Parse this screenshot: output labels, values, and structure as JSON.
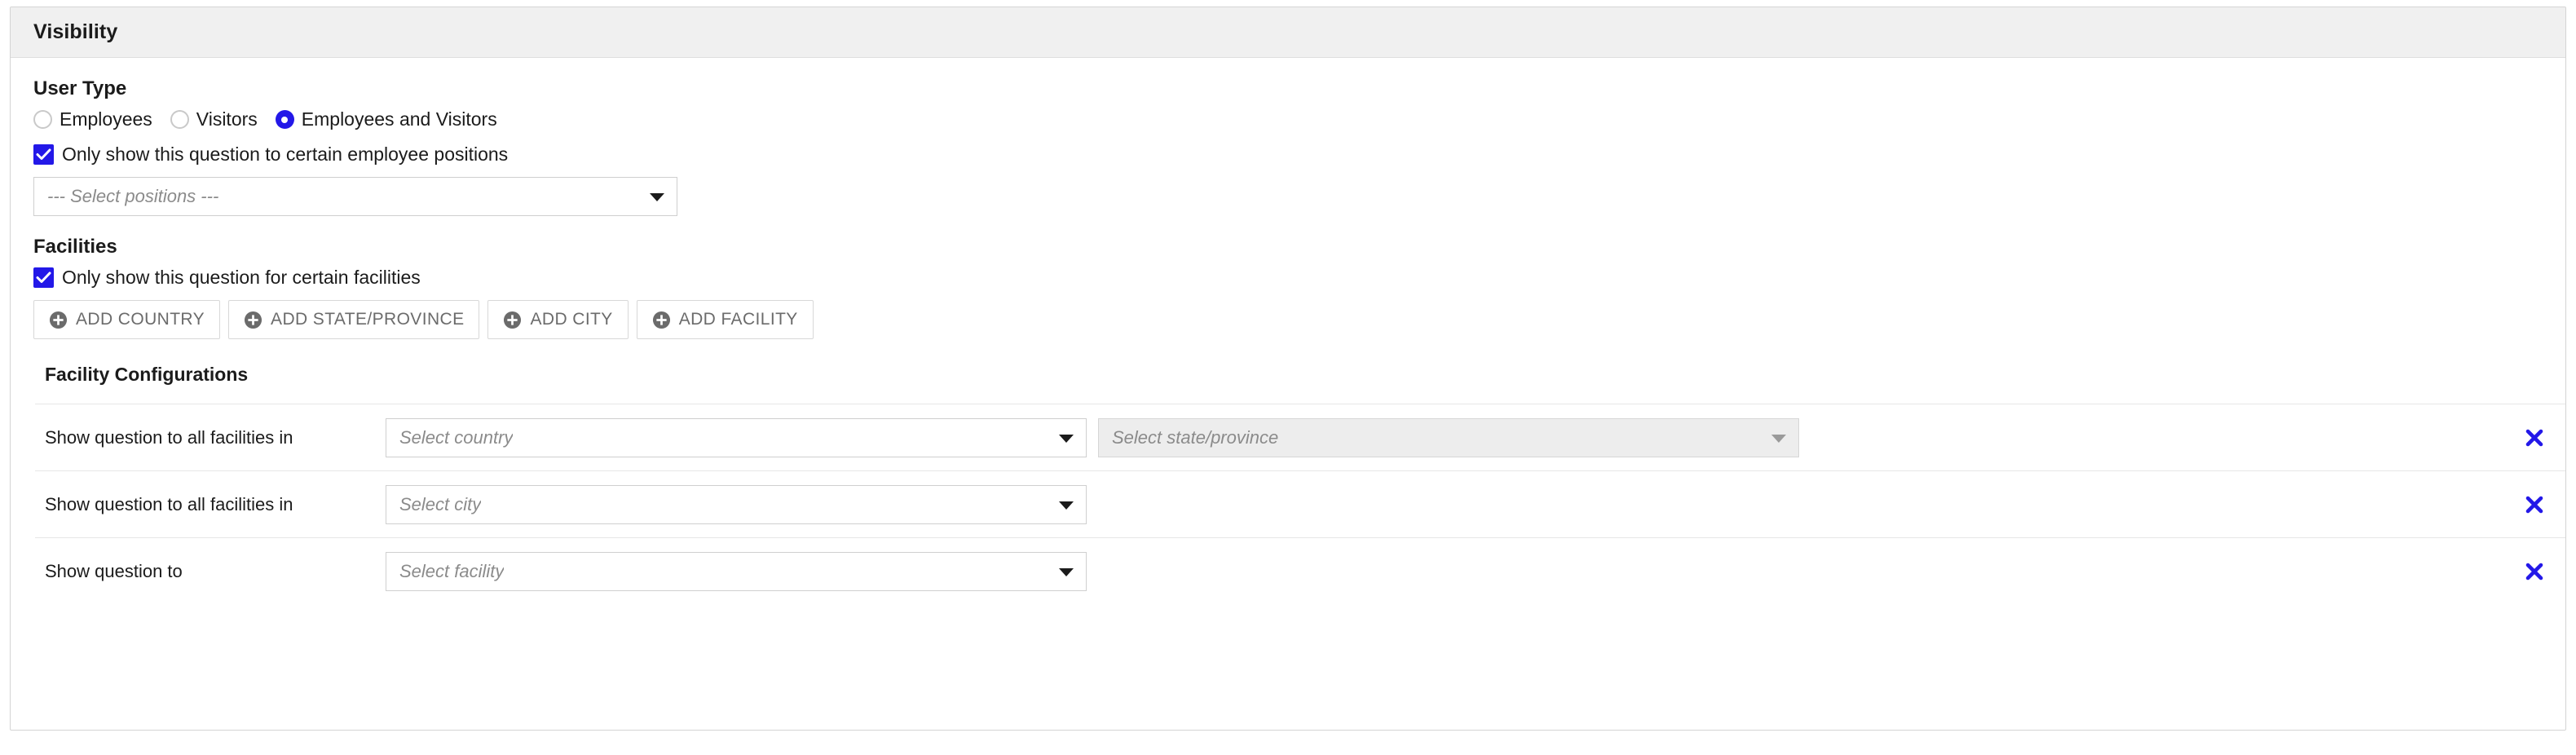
{
  "panel": {
    "header_title": "Visibility"
  },
  "user_type": {
    "section_label": "User Type",
    "options": [
      {
        "label": "Employees",
        "selected": false
      },
      {
        "label": "Visitors",
        "selected": false
      },
      {
        "label": "Employees and Visitors",
        "selected": true
      }
    ],
    "positions_checkbox": {
      "label": "Only show this question to certain employee positions",
      "checked": true
    },
    "positions_select": {
      "placeholder": "--- Select positions ---",
      "value": ""
    }
  },
  "facilities": {
    "section_label": "Facilities",
    "facilities_checkbox": {
      "label": "Only show this question for certain facilities",
      "checked": true
    },
    "add_buttons": [
      {
        "label": "ADD COUNTRY",
        "icon": "plus-circle-icon"
      },
      {
        "label": "ADD STATE/PROVINCE",
        "icon": "plus-circle-icon"
      },
      {
        "label": "ADD CITY",
        "icon": "plus-circle-icon"
      },
      {
        "label": "ADD FACILITY",
        "icon": "plus-circle-icon"
      }
    ],
    "configurations": {
      "title": "Facility Configurations",
      "rows": [
        {
          "label": "Show question to all facilities in",
          "primary_placeholder": "Select country",
          "secondary_placeholder": "Select state/province",
          "secondary_disabled": true,
          "delete_icon": "close-icon"
        },
        {
          "label": "Show question to all facilities in",
          "primary_placeholder": "Select city",
          "secondary_placeholder": "",
          "secondary_disabled": false,
          "delete_icon": "close-icon"
        },
        {
          "label": "Show question to",
          "primary_placeholder": "Select facility",
          "secondary_placeholder": "",
          "secondary_disabled": false,
          "delete_icon": "close-icon"
        }
      ]
    }
  },
  "colors": {
    "accent": "#2318e8",
    "header_bg": "#f0f0f0",
    "border": "#d4d4d4",
    "disabled_bg": "#ededed",
    "placeholder_text": "#8b8b8b",
    "button_text": "#6b6b6b"
  }
}
